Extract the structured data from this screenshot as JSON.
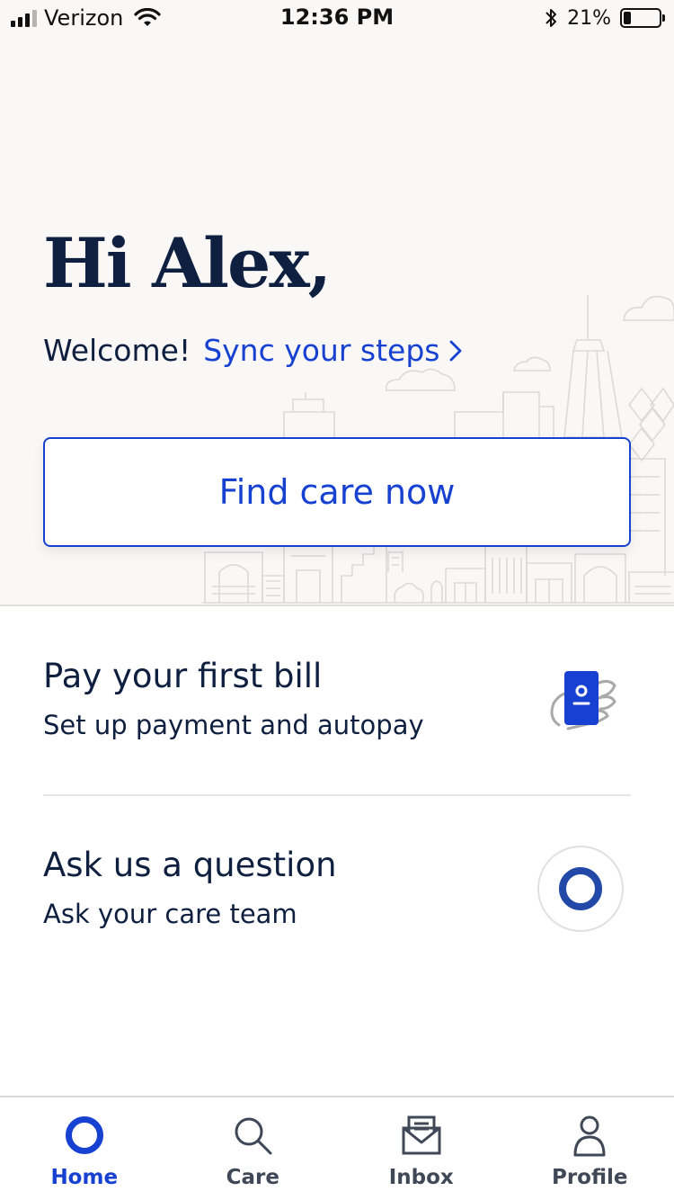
{
  "status_bar": {
    "carrier": "Verizon",
    "time": "12:36 PM",
    "battery_percent": "21%",
    "battery_level": 0.21,
    "signal_bars": 3,
    "icons": [
      "signal-icon",
      "wifi-icon",
      "bluetooth-icon",
      "battery-icon"
    ]
  },
  "hero": {
    "greeting": "Hi Alex,",
    "welcome_text": "Welcome!",
    "sync_link": "Sync your steps",
    "find_care_label": "Find care now"
  },
  "cards": {
    "bill": {
      "title": "Pay your first bill",
      "subtitle": "Set up payment and autopay",
      "icon": "payment-card-hand-icon"
    },
    "ask": {
      "title": "Ask us a question",
      "subtitle": "Ask your care team",
      "icon": "chat-ring-icon"
    }
  },
  "tab_bar": {
    "tabs": [
      {
        "label": "Home",
        "icon": "home-ring-icon",
        "active": true
      },
      {
        "label": "Care",
        "icon": "search-icon",
        "active": false
      },
      {
        "label": "Inbox",
        "icon": "inbox-icon",
        "active": false
      },
      {
        "label": "Profile",
        "icon": "profile-icon",
        "active": false
      }
    ]
  },
  "colors": {
    "accent": "#1741d1",
    "text_dark": "#0e1f3f",
    "hero_bg": "#f9f8f7",
    "ring_blue": "#2249a8"
  }
}
